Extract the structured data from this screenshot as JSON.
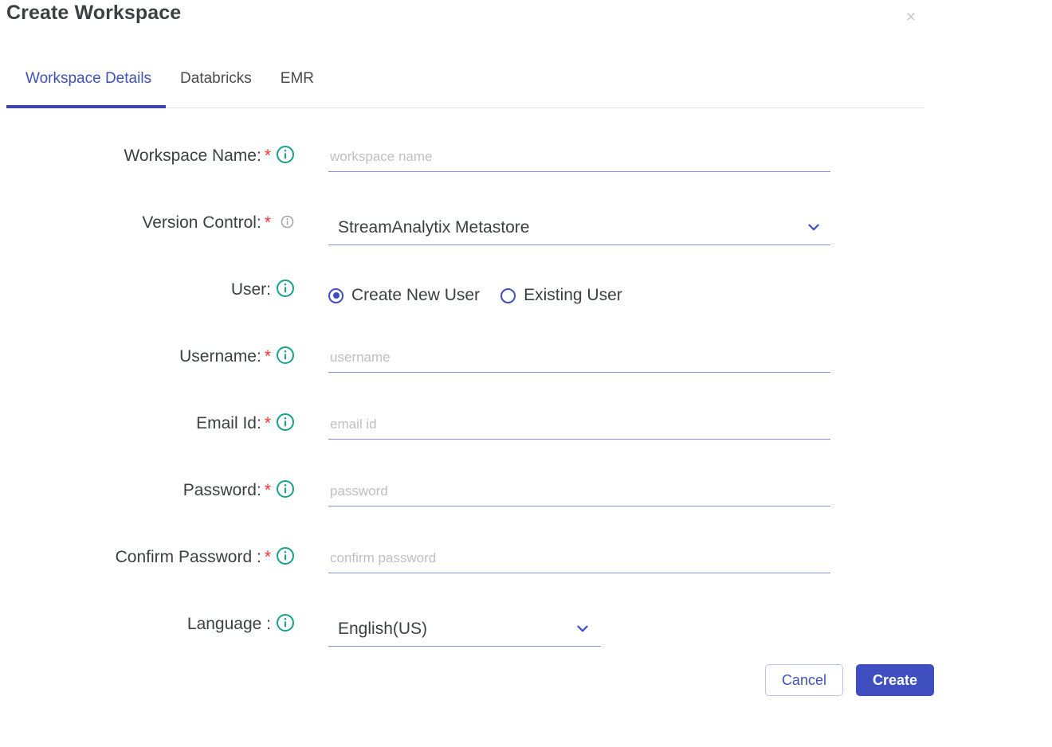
{
  "dialog": {
    "title": "Create Workspace",
    "close_label": "×"
  },
  "tabs": [
    {
      "label": "Workspace Details",
      "active": true
    },
    {
      "label": "Databricks",
      "active": false
    },
    {
      "label": "EMR",
      "active": false
    }
  ],
  "form": {
    "workspace_name": {
      "label": "Workspace Name:",
      "required": "*",
      "placeholder": "workspace name",
      "value": "",
      "icon": "info-icon"
    },
    "version_control": {
      "label": "Version Control:",
      "required": "*",
      "selected": "StreamAnalytix Metastore",
      "icon": "info-icon-small",
      "chevron": "chevron-down-icon"
    },
    "user": {
      "label": "User:",
      "icon": "info-icon",
      "options": [
        {
          "label": "Create New User",
          "selected": true
        },
        {
          "label": "Existing User",
          "selected": false
        }
      ]
    },
    "username": {
      "label": "Username:",
      "required": "*",
      "placeholder": "username",
      "value": "",
      "icon": "info-icon"
    },
    "email_id": {
      "label": "Email Id:",
      "required": "*",
      "placeholder": "email id",
      "value": "",
      "icon": "info-icon"
    },
    "password": {
      "label": "Password:",
      "required": "*",
      "placeholder": "password",
      "value": "",
      "icon": "info-icon"
    },
    "confirm_password": {
      "label": "Confirm Password :",
      "required": "*",
      "placeholder": "confirm password",
      "value": "",
      "icon": "info-icon"
    },
    "language": {
      "label": "Language :",
      "selected": "English(US)",
      "icon": "info-icon",
      "chevron": "chevron-down-icon"
    }
  },
  "footer": {
    "cancel_label": "Cancel",
    "create_label": "Create"
  },
  "colors": {
    "accent_indigo": "#3f4fbf",
    "tab_active": "#3f51b5",
    "info_teal": "#19a08c",
    "required_red": "#f0342f",
    "underline": "#8592d6",
    "placeholder": "#bfbfbf"
  }
}
